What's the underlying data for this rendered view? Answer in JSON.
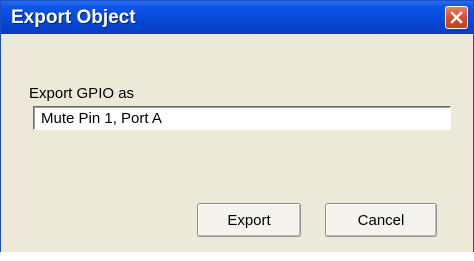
{
  "window": {
    "title": "Export Object"
  },
  "form": {
    "label": "Export GPIO as",
    "input_value": "Mute Pin 1, Port A"
  },
  "buttons": {
    "export_label": "Export",
    "cancel_label": "Cancel"
  },
  "icons": {
    "close": "close-icon"
  },
  "colors": {
    "titlebar": "#0849d8",
    "close_button": "#d8502f",
    "dialog_background": "#ece9d8"
  }
}
